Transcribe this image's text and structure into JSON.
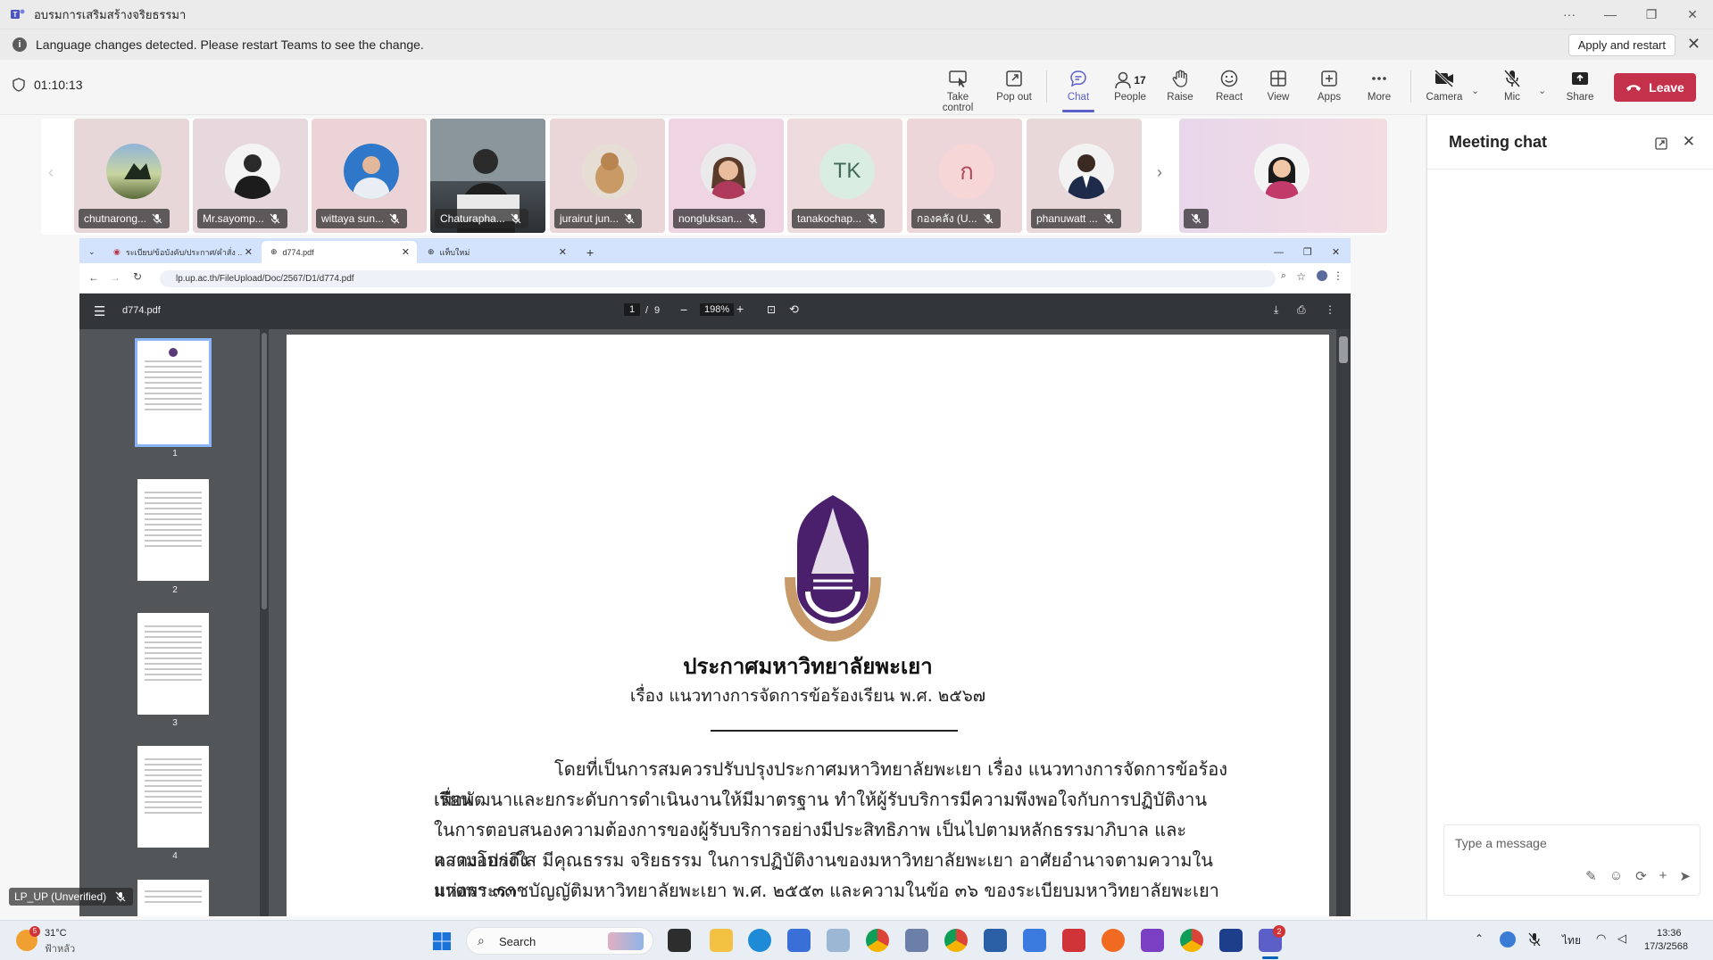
{
  "window": {
    "title": "อบรมการเสริมสร้างจริยธรรมา",
    "more": "···",
    "minimize": "—",
    "restore": "❐",
    "close": "✕"
  },
  "notice": {
    "message": "Language changes detected. Please restart Teams to see the change.",
    "apply_label": "Apply and restart"
  },
  "meeting": {
    "timer": "01:10:13",
    "people_count": "17"
  },
  "toolbar": [
    {
      "label": "Take control",
      "icon": "take-control-icon"
    },
    {
      "label": "Pop out",
      "icon": "pop-out-icon"
    },
    {
      "label": "Chat",
      "icon": "chat-icon",
      "active": true
    },
    {
      "label": "People",
      "icon": "people-icon"
    },
    {
      "label": "Raise",
      "icon": "raise-hand-icon"
    },
    {
      "label": "React",
      "icon": "react-icon"
    },
    {
      "label": "View",
      "icon": "view-icon"
    },
    {
      "label": "Apps",
      "icon": "apps-icon"
    },
    {
      "label": "More",
      "icon": "more-icon"
    },
    {
      "label": "Camera",
      "icon": "camera-off-icon"
    },
    {
      "label": "Mic",
      "icon": "mic-off-icon"
    },
    {
      "label": "Share",
      "icon": "share-icon"
    }
  ],
  "leave_label": "Leave",
  "participants": [
    {
      "name": "chutnarong..."
    },
    {
      "name": "Mr.sayomp..."
    },
    {
      "name": "wittaya sun..."
    },
    {
      "name": "Chaturapha..."
    },
    {
      "name": "jurairut jun..."
    },
    {
      "name": "nongluksan..."
    },
    {
      "name": "tanakochap...",
      "initials": "TK"
    },
    {
      "name": "กองคลัง (U...",
      "initials": "ก"
    },
    {
      "name": "phanuwatt ..."
    },
    {
      "name": ""
    }
  ],
  "browser": {
    "tabs": [
      {
        "title": "ระเบียบ/ข้อบังคับ/ประกาศ/คำสั่ง ..."
      },
      {
        "title": "d774.pdf"
      },
      {
        "title": "แท็บใหม่"
      }
    ],
    "url": "lp.up.ac.th/FileUpload/Doc/2567/D1/d774.pdf",
    "pdf": {
      "filename": "d774.pdf",
      "page_current": "1",
      "page_sep": "/",
      "page_total": "9",
      "zoom": "198%",
      "thumb_numbers": [
        "1",
        "2",
        "3",
        "4"
      ]
    }
  },
  "document": {
    "title": "ประกาศมหาวิทยาลัยพะเยา",
    "subject": "เรื่อง  แนวทางการจัดการข้อร้องเรียน พ.ศ. ๒๕๖๗",
    "lines": [
      "โดยที่เป็นการสมควรปรับปรุงประกาศมหาวิทยาลัยพะเยา เรื่อง แนวทางการจัดการข้อร้องเรียน",
      "เพื่อพัฒนาและยกระดับการดำเนินงานให้มีมาตรฐาน ทำให้ผู้รับบริการมีความพึงพอใจกับการปฏิบัติงาน",
      "ในการตอบสนองความต้องการของผู้รับบริการอย่างมีประสิทธิภาพ เป็นไปตามหลักธรรมาภิบาล และแสดงออกถึง",
      "ความโปร่งใส มีคุณธรรม จริยธรรม ในการปฏิบัติงานของมหาวิทยาลัยพะเยา อาศัยอำนาจตามความในมาตรา ๓๓",
      "แห่งพระราชบัญญัติมหาวิทยาลัยพะเยา พ.ศ. ๒๕๕๓ และความในข้อ ๓๖ ของระเบียบมหาวิทยาลัยพะเยา"
    ]
  },
  "chat": {
    "title": "Meeting chat",
    "placeholder": "Type a message"
  },
  "self_view": {
    "name": "LP_UP (Unverified)"
  },
  "taskbar": {
    "weather_temp": "31°C",
    "weather_desc": "ฟ้าหลัว",
    "weather_badge": "5",
    "search_label": "Search",
    "lang": "ไทย",
    "time": "13:36",
    "date": "17/3/2568",
    "teams_badge": "2"
  }
}
